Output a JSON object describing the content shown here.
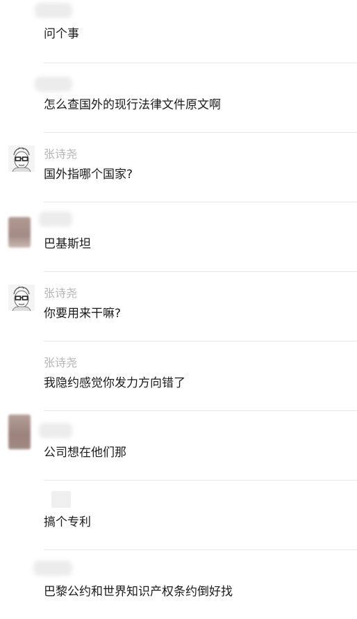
{
  "messages": [
    {
      "sender": "",
      "text": "问个事"
    },
    {
      "sender": "",
      "text": "怎么查国外的现行法律文件原文啊"
    },
    {
      "sender": "张诗尧",
      "text": "国外指哪个国家?"
    },
    {
      "sender": "",
      "text": "巴基斯坦"
    },
    {
      "sender": "张诗尧",
      "text": "你要用来干嘛?"
    },
    {
      "sender": "张诗尧",
      "text": "我隐约感觉你发力方向错了"
    },
    {
      "sender": "",
      "text": "公司想在他们那"
    },
    {
      "sender": "",
      "text": "搞个专利"
    },
    {
      "sender": "",
      "text": "巴黎公约和世界知识产权条约倒好找"
    }
  ],
  "icons": {
    "sketch_avatar": "cartoon-face-avatar-icon",
    "blurred_avatar": "blurred-avatar"
  },
  "colors": {
    "sender_name": "#b4b4b4",
    "message_text": "#1a1a1a",
    "divider": "#e8e8e8",
    "blurred_avatar_tone": "#a9918a"
  }
}
